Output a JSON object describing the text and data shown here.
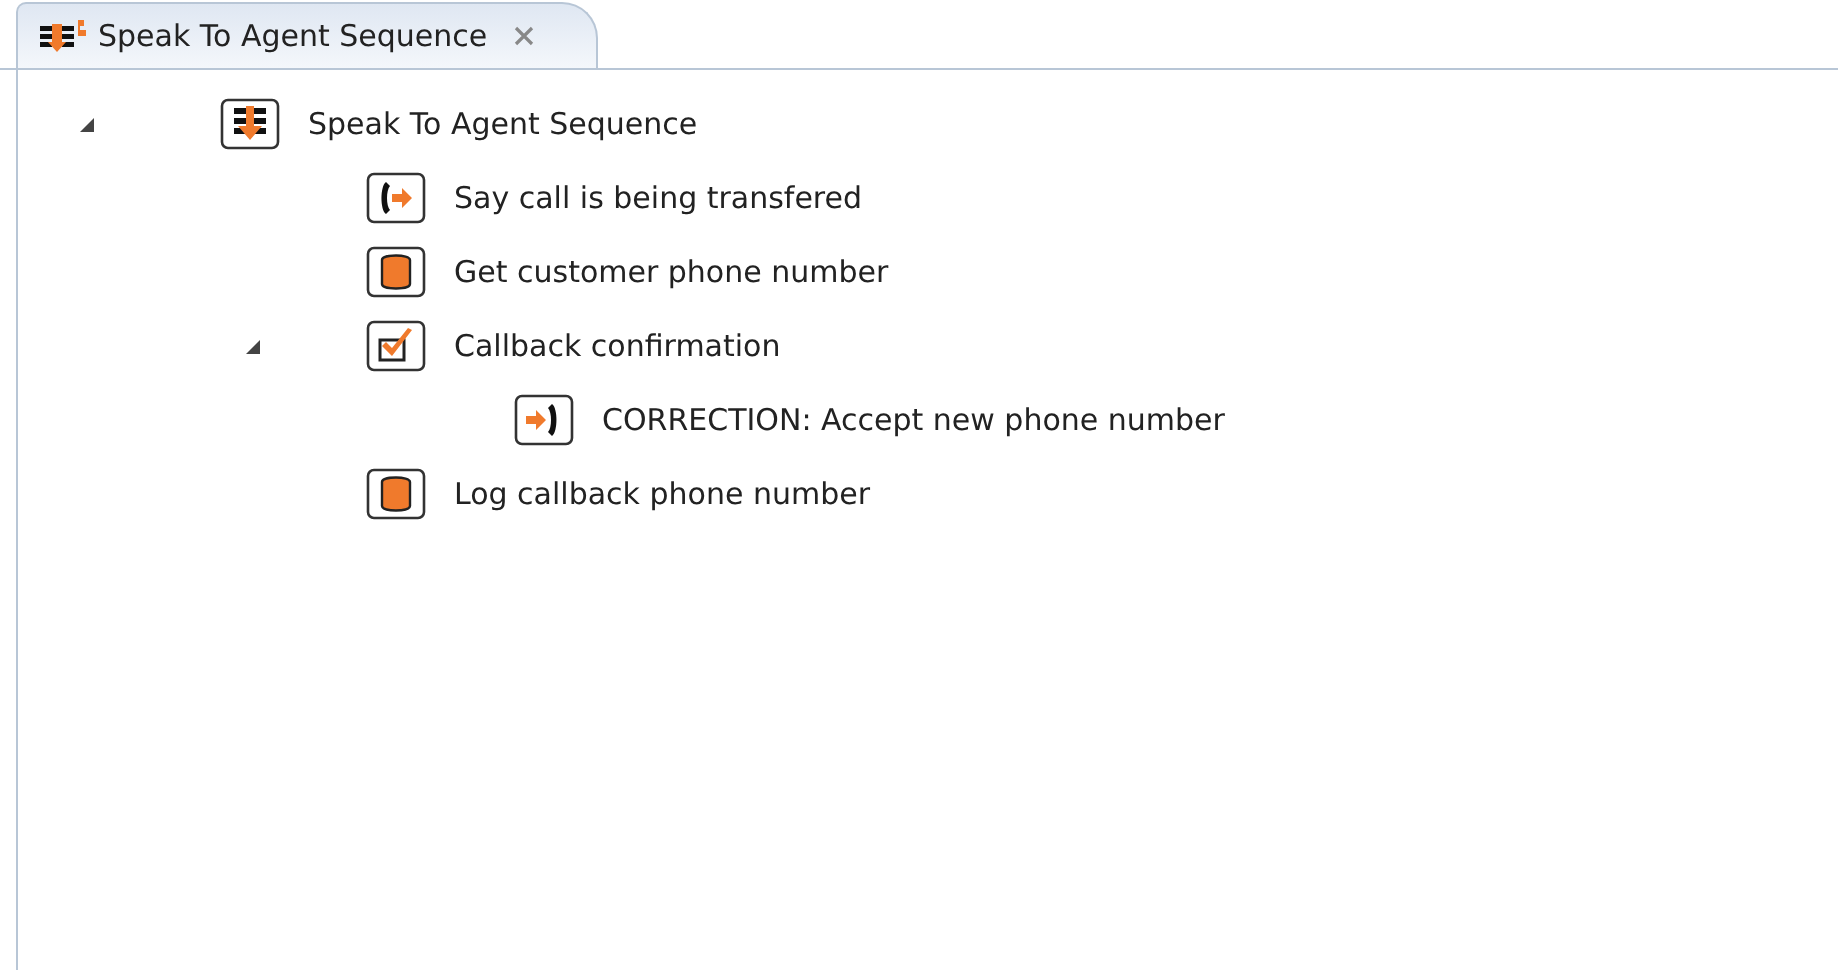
{
  "tab": {
    "title": "Speak To Agent Sequence",
    "selected": true
  },
  "tree": [
    {
      "label": "Speak To Agent Sequence",
      "kind": "sequence",
      "expanded": true,
      "children": [
        {
          "label": "Say call is being transfered",
          "kind": "transfer"
        },
        {
          "label": "Get customer phone number",
          "kind": "database"
        },
        {
          "label": "Callback confirmation",
          "kind": "confirmation",
          "expanded": true,
          "children": [
            {
              "label": "CORRECTION: Accept new phone number",
              "kind": "correction"
            }
          ]
        },
        {
          "label": "Log callback phone number",
          "kind": "database"
        }
      ]
    }
  ]
}
